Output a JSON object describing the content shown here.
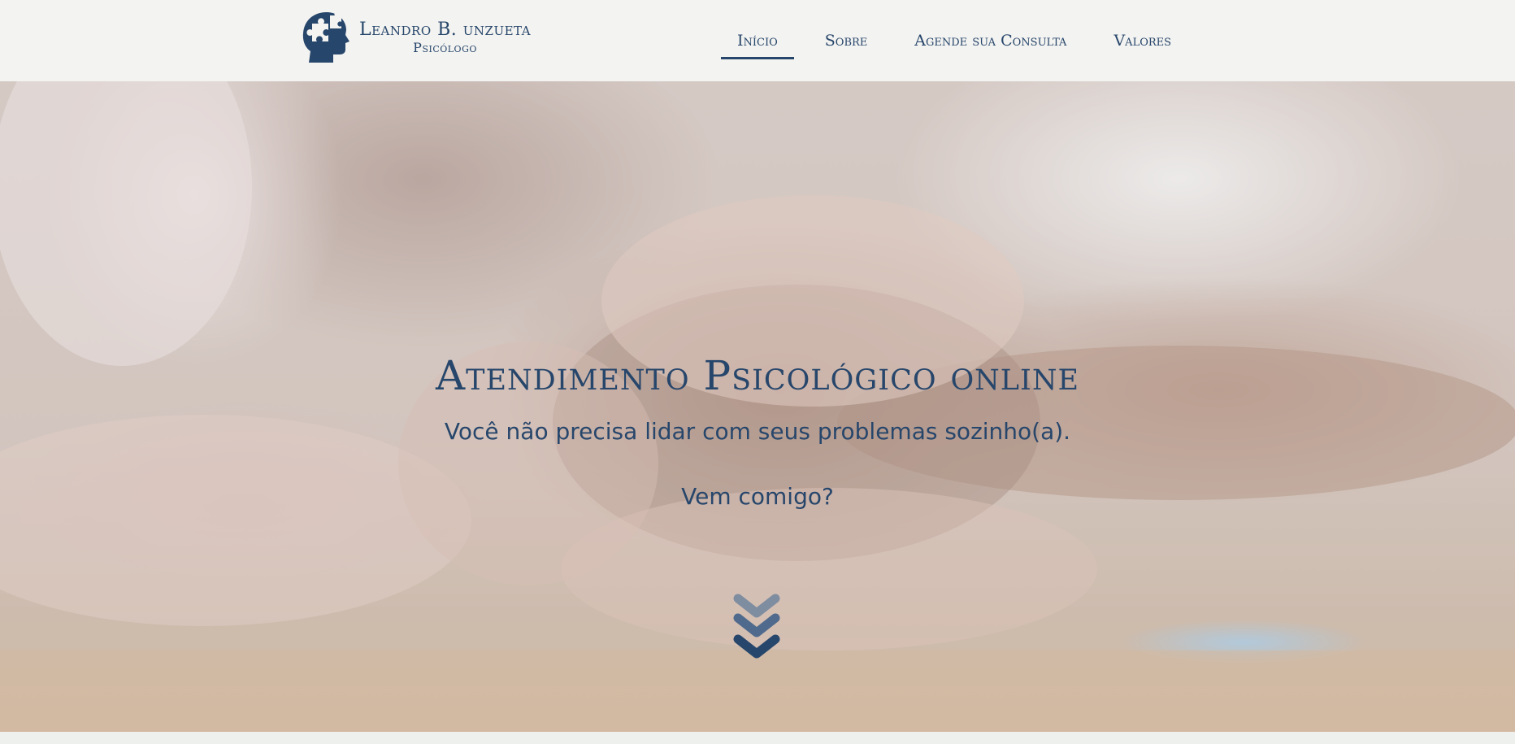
{
  "header": {
    "logo": {
      "name": "Leandro B. unzueta",
      "subtitle": "Psicólogo",
      "icon": "head-puzzle-icon"
    },
    "nav": [
      {
        "label": "Início",
        "active": true
      },
      {
        "label": "Sobre",
        "active": false
      },
      {
        "label": "Agende sua Consulta",
        "active": false
      },
      {
        "label": "Valores",
        "active": false
      }
    ]
  },
  "hero": {
    "title": "Atendimento Psicológico online",
    "subtitle": "Você não precisa lidar com seus problemas sozinho(a).",
    "question": "Vem comigo?",
    "background_image": "holding-hands-photo",
    "scroll_icon": "triple-chevron-down-icon"
  },
  "colors": {
    "brand": "#27466b",
    "header_background": "#f3f3f1"
  }
}
